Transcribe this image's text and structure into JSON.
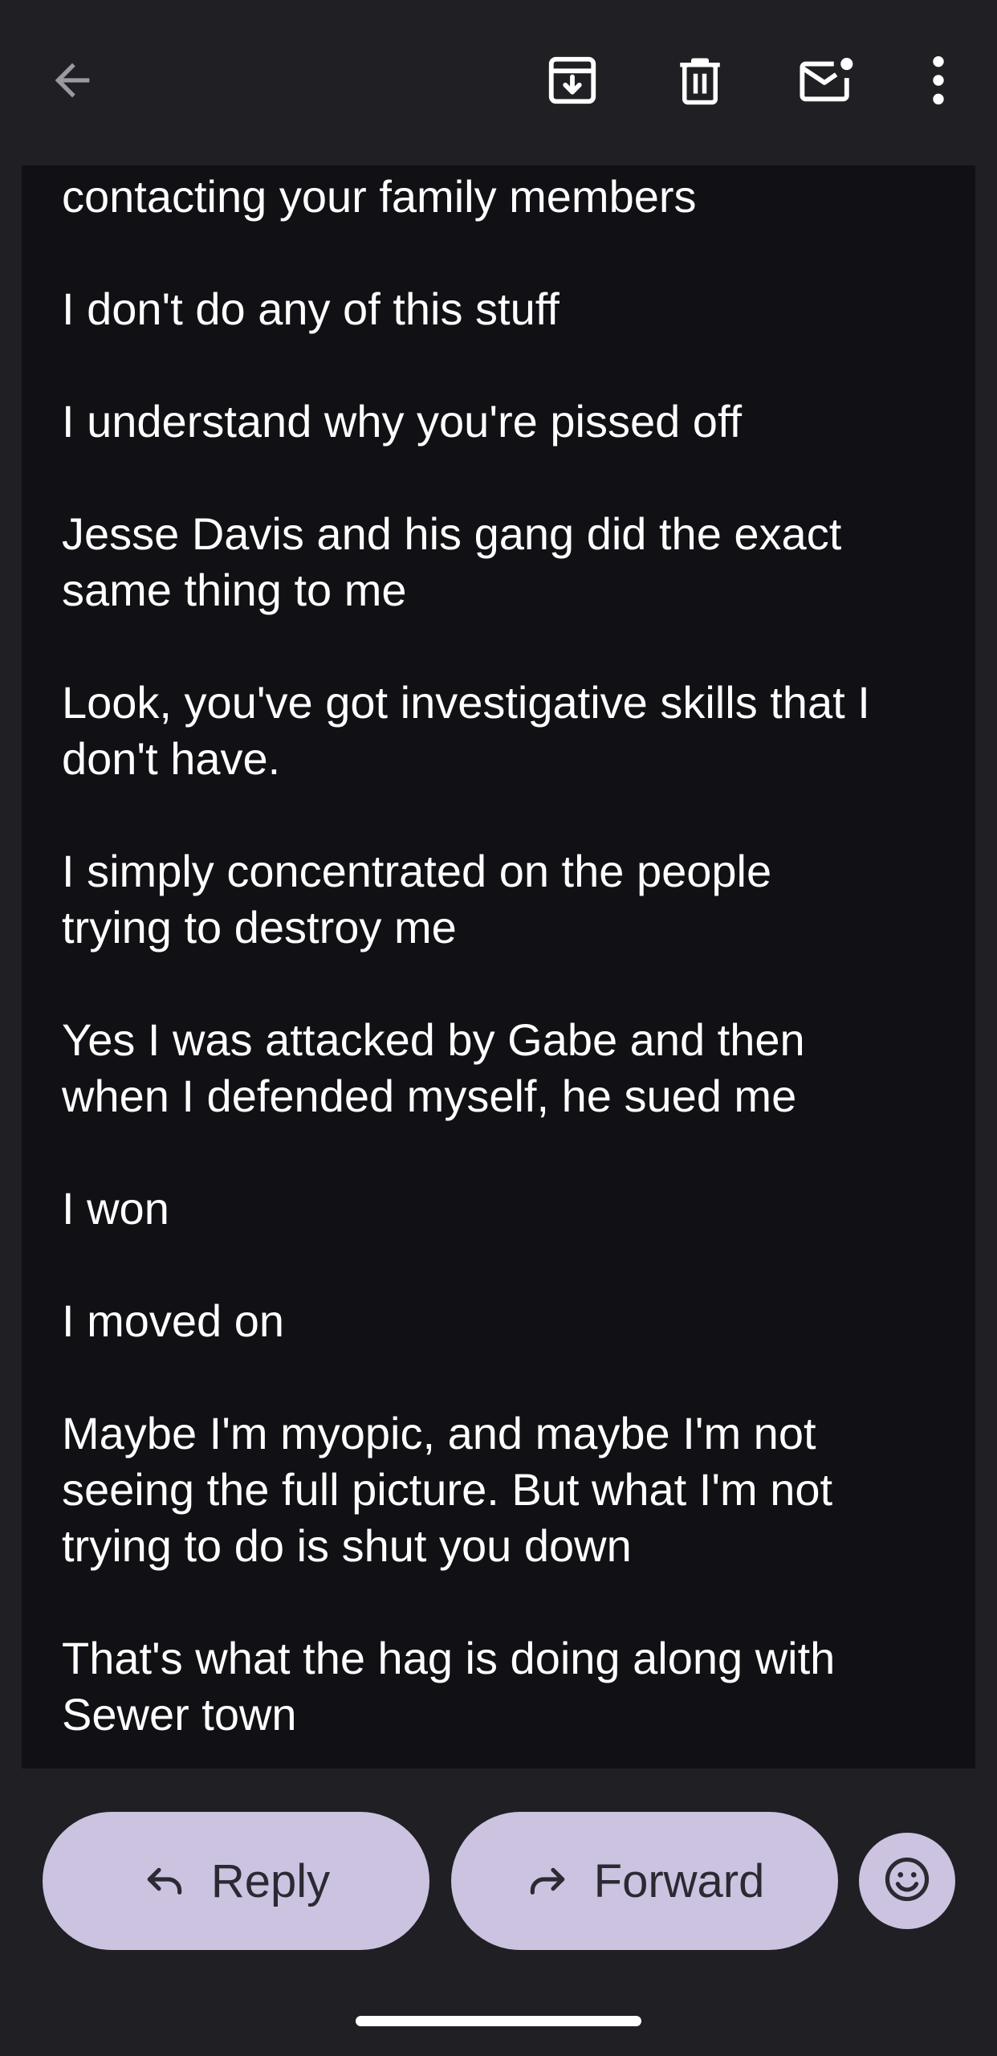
{
  "toolbar": {
    "back_icon": "arrow-left-icon",
    "archive_icon": "archive-icon",
    "delete_icon": "trash-icon",
    "mark_unread_icon": "mail-unread-icon",
    "more_icon": "more-vert-icon"
  },
  "message": {
    "paragraphs": [
      "contacting your family members",
      "I don't do any of this stuff",
      "I understand why you're pissed off",
      "Jesse Davis and his gang did the exact\nsame thing to me",
      "Look, you've got investigative skills that I\ndon't have.",
      "I simply concentrated on the people\ntrying to destroy me",
      "Yes I was attacked by Gabe and then\nwhen I defended myself, he sued me",
      "I won",
      "I moved on",
      "Maybe I'm myopic, and maybe I'm not\nseeing the full picture. But what I'm not\ntrying to do is shut you down",
      "That's what the hag is doing along with\nSewer town"
    ]
  },
  "actions": {
    "reply_label": "Reply",
    "forward_label": "Forward",
    "reply_icon": "reply-icon",
    "forward_icon": "forward-icon",
    "emoji_icon": "emoji-reaction-icon"
  },
  "colors": {
    "app_bg": "#1f1f24",
    "message_bg": "#111115",
    "pill_bg": "#cbc3e0",
    "text": "#ffffff"
  }
}
